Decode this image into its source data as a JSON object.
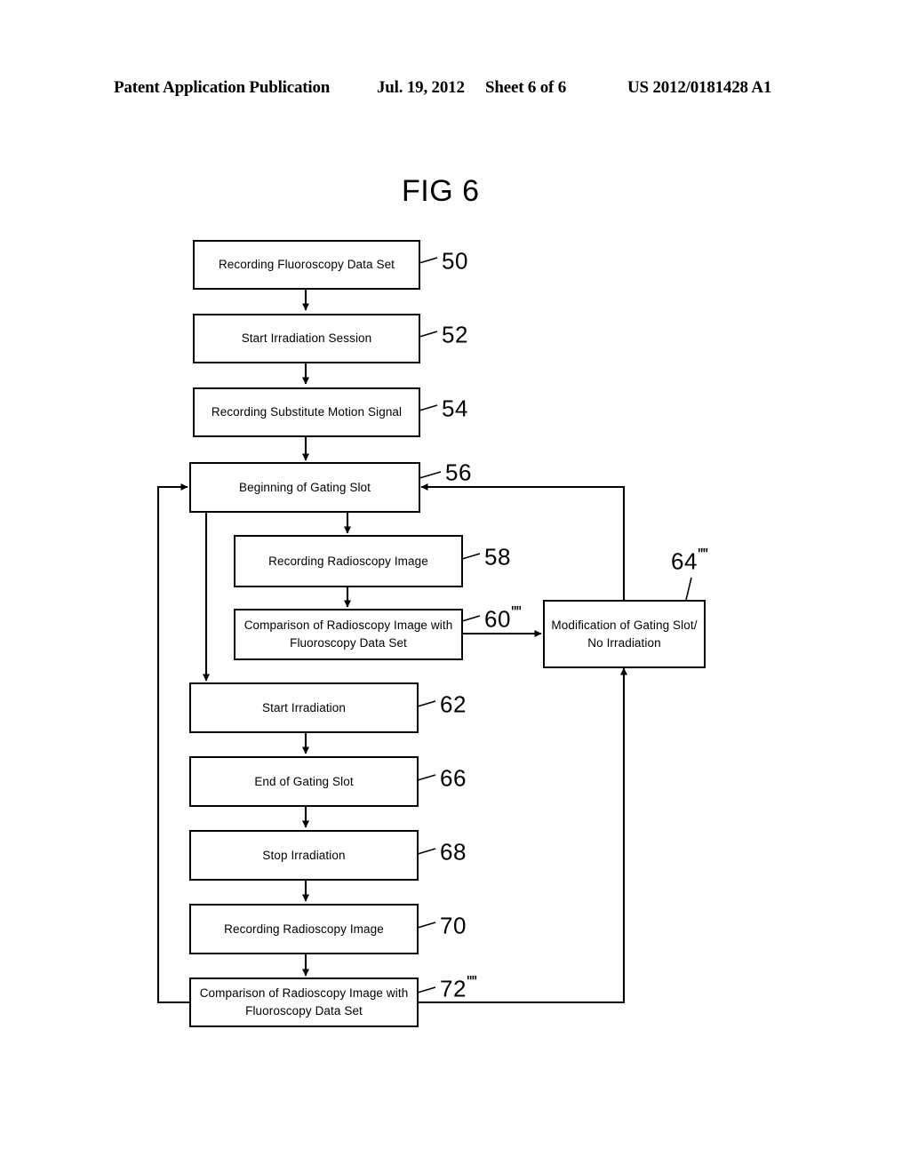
{
  "header": {
    "publication": "Patent Application Publication",
    "date": "Jul. 19, 2012",
    "sheet": "Sheet 6 of 6",
    "number": "US 2012/0181428 A1"
  },
  "figure": {
    "title": "FIG 6"
  },
  "flowchart": {
    "nodes": [
      {
        "id": "50",
        "ref": "50",
        "ref_primes": "",
        "line1": "Recording Fluoroscopy Data Set",
        "line2": ""
      },
      {
        "id": "52",
        "ref": "52",
        "ref_primes": "",
        "line1": "Start Irradiation Session",
        "line2": ""
      },
      {
        "id": "54",
        "ref": "54",
        "ref_primes": "",
        "line1": "Recording Substitute Motion Signal",
        "line2": ""
      },
      {
        "id": "56",
        "ref": "56",
        "ref_primes": "",
        "line1": "Beginning of Gating Slot",
        "line2": ""
      },
      {
        "id": "58",
        "ref": "58",
        "ref_primes": "",
        "line1": "Recording Radioscopy Image",
        "line2": ""
      },
      {
        "id": "60",
        "ref": "60",
        "ref_primes": "''''",
        "line1": "Comparison of Radioscopy Image with",
        "line2": "Fluoroscopy Data Set"
      },
      {
        "id": "64",
        "ref": "64",
        "ref_primes": "''''",
        "line1": "Modification of Gating Slot/",
        "line2": "No Irradiation"
      },
      {
        "id": "62",
        "ref": "62",
        "ref_primes": "",
        "line1": "Start Irradiation",
        "line2": ""
      },
      {
        "id": "66",
        "ref": "66",
        "ref_primes": "",
        "line1": "End of Gating Slot",
        "line2": ""
      },
      {
        "id": "68",
        "ref": "68",
        "ref_primes": "",
        "line1": "Stop Irradiation",
        "line2": ""
      },
      {
        "id": "70",
        "ref": "70",
        "ref_primes": "",
        "line1": "Recording Radioscopy Image",
        "line2": ""
      },
      {
        "id": "72",
        "ref": "72",
        "ref_primes": "''''",
        "line1": "Comparison of Radioscopy Image with",
        "line2": "Fluoroscopy Data Set"
      }
    ]
  },
  "colors": {
    "ink": "#000000",
    "paper": "#ffffff"
  }
}
